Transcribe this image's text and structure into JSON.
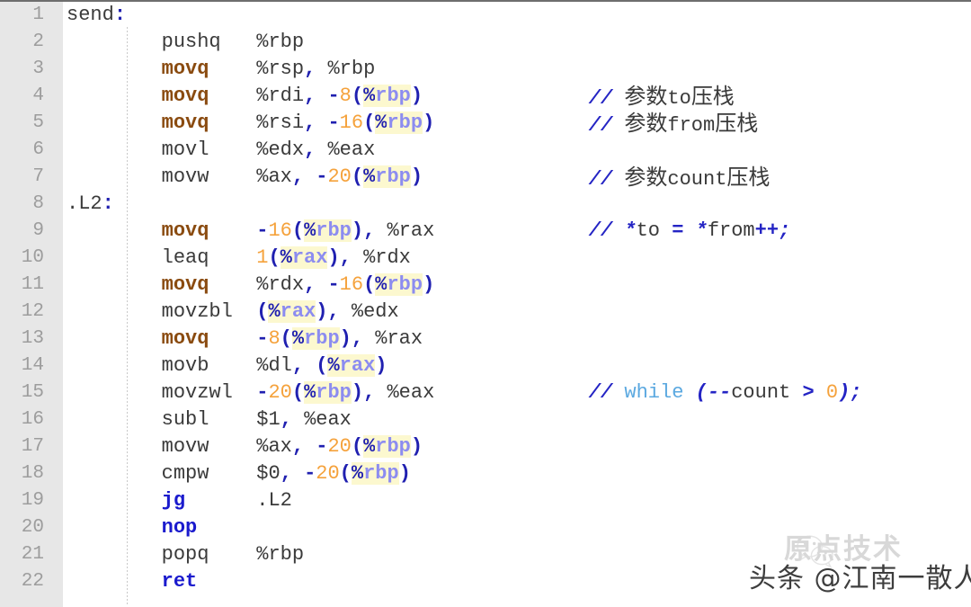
{
  "editor": {
    "language": "x86 AT&T assembly",
    "line_count": 22,
    "gutter_color": "#e7e7e7",
    "background_color": "#ffffff",
    "colors": {
      "mnemonic": "#8a4b10",
      "jump_mnemonic": "#1a1acd",
      "punctuation": "#2020b0",
      "number": "#f5a23c",
      "register": "#8c8cf0",
      "register_highlight": "#fcf8cf",
      "keyword": "#5aa8e0",
      "comment_slash": "#2424c4",
      "plain_text": "#3a3a3a",
      "line_number": "#9d9d9d"
    }
  },
  "line_numbers": [
    "1",
    "2",
    "3",
    "4",
    "5",
    "6",
    "7",
    "8",
    "9",
    "10",
    "11",
    "12",
    "13",
    "14",
    "15",
    "16",
    "17",
    "18",
    "19",
    "20",
    "21",
    "22"
  ],
  "lines": [
    {
      "n": "1",
      "plain": "send:",
      "tokens": [
        {
          "t": "send",
          "c": "t-label"
        },
        {
          "t": ":",
          "c": "t-punct"
        }
      ]
    },
    {
      "n": "2",
      "plain": "        pushq   %rbp",
      "tokens": [
        {
          "t": "        ",
          "c": "t-plain"
        },
        {
          "t": "pushq",
          "c": "t-plain"
        },
        {
          "t": "   ",
          "c": "t-plain"
        },
        {
          "t": "%rbp",
          "c": "t-plain"
        }
      ]
    },
    {
      "n": "3",
      "plain": "        movq    %rsp, %rbp",
      "tokens": [
        {
          "t": "        ",
          "c": "t-plain"
        },
        {
          "t": "movq",
          "c": "t-mnem"
        },
        {
          "t": "    ",
          "c": "t-plain"
        },
        {
          "t": "%rsp",
          "c": "t-plain"
        },
        {
          "t": ",",
          "c": "t-punct"
        },
        {
          "t": " ",
          "c": "t-plain"
        },
        {
          "t": "%rbp",
          "c": "t-plain"
        }
      ]
    },
    {
      "n": "4",
      "plain": "        movq    %rdi, -8(%rbp)",
      "comment": "// 参数to压栈",
      "tokens": [
        {
          "t": "        ",
          "c": "t-plain"
        },
        {
          "t": "movq",
          "c": "t-mnem"
        },
        {
          "t": "    ",
          "c": "t-plain"
        },
        {
          "t": "%rdi",
          "c": "t-plain"
        },
        {
          "t": ",",
          "c": "t-punct"
        },
        {
          "t": " ",
          "c": "t-plain"
        },
        {
          "t": "-",
          "c": "t-punct"
        },
        {
          "t": "8",
          "c": "t-num"
        },
        {
          "t": "(",
          "c": "t-punct"
        },
        {
          "t": "%",
          "c": "t-punct hl"
        },
        {
          "t": "rbp",
          "c": "t-reg hl"
        },
        {
          "t": ")",
          "c": "t-punct"
        }
      ],
      "comment_tokens": [
        {
          "t": "//",
          "c": "t-com-slash"
        },
        {
          "t": " ",
          "c": "t-com-text"
        },
        {
          "t": "参数",
          "c": "t-com-cjk"
        },
        {
          "t": "to",
          "c": "t-com-text"
        },
        {
          "t": "压栈",
          "c": "t-com-cjk"
        }
      ]
    },
    {
      "n": "5",
      "plain": "        movq    %rsi, -16(%rbp)",
      "comment": "// 参数from压栈",
      "tokens": [
        {
          "t": "        ",
          "c": "t-plain"
        },
        {
          "t": "movq",
          "c": "t-mnem"
        },
        {
          "t": "    ",
          "c": "t-plain"
        },
        {
          "t": "%rsi",
          "c": "t-plain"
        },
        {
          "t": ",",
          "c": "t-punct"
        },
        {
          "t": " ",
          "c": "t-plain"
        },
        {
          "t": "-",
          "c": "t-punct"
        },
        {
          "t": "16",
          "c": "t-num"
        },
        {
          "t": "(",
          "c": "t-punct"
        },
        {
          "t": "%",
          "c": "t-punct hl"
        },
        {
          "t": "rbp",
          "c": "t-reg hl"
        },
        {
          "t": ")",
          "c": "t-punct"
        }
      ],
      "comment_tokens": [
        {
          "t": "//",
          "c": "t-com-slash"
        },
        {
          "t": " ",
          "c": "t-com-text"
        },
        {
          "t": "参数",
          "c": "t-com-cjk"
        },
        {
          "t": "from",
          "c": "t-com-text"
        },
        {
          "t": "压栈",
          "c": "t-com-cjk"
        }
      ]
    },
    {
      "n": "6",
      "plain": "        movl    %edx, %eax",
      "tokens": [
        {
          "t": "        ",
          "c": "t-plain"
        },
        {
          "t": "movl",
          "c": "t-plain"
        },
        {
          "t": "    ",
          "c": "t-plain"
        },
        {
          "t": "%edx",
          "c": "t-plain"
        },
        {
          "t": ",",
          "c": "t-punct"
        },
        {
          "t": " ",
          "c": "t-plain"
        },
        {
          "t": "%eax",
          "c": "t-plain"
        }
      ]
    },
    {
      "n": "7",
      "plain": "        movw    %ax, -20(%rbp)",
      "comment": "// 参数count压栈",
      "tokens": [
        {
          "t": "        ",
          "c": "t-plain"
        },
        {
          "t": "movw",
          "c": "t-plain"
        },
        {
          "t": "    ",
          "c": "t-plain"
        },
        {
          "t": "%ax",
          "c": "t-plain"
        },
        {
          "t": ",",
          "c": "t-punct"
        },
        {
          "t": " ",
          "c": "t-plain"
        },
        {
          "t": "-",
          "c": "t-punct"
        },
        {
          "t": "20",
          "c": "t-num"
        },
        {
          "t": "(",
          "c": "t-punct"
        },
        {
          "t": "%",
          "c": "t-punct hl"
        },
        {
          "t": "rbp",
          "c": "t-reg hl"
        },
        {
          "t": ")",
          "c": "t-punct"
        }
      ],
      "comment_tokens": [
        {
          "t": "//",
          "c": "t-com-slash"
        },
        {
          "t": " ",
          "c": "t-com-text"
        },
        {
          "t": "参数",
          "c": "t-com-cjk"
        },
        {
          "t": "count",
          "c": "t-com-text"
        },
        {
          "t": "压栈",
          "c": "t-com-cjk"
        }
      ]
    },
    {
      "n": "8",
      "plain": ".L2:",
      "tokens": [
        {
          "t": ".L2",
          "c": "t-label"
        },
        {
          "t": ":",
          "c": "t-punct"
        }
      ]
    },
    {
      "n": "9",
      "plain": "        movq    -16(%rbp), %rax",
      "comment": "// *to = *from++;",
      "tokens": [
        {
          "t": "        ",
          "c": "t-plain"
        },
        {
          "t": "movq",
          "c": "t-mnem"
        },
        {
          "t": "    ",
          "c": "t-plain"
        },
        {
          "t": "-",
          "c": "t-punct"
        },
        {
          "t": "16",
          "c": "t-num"
        },
        {
          "t": "(",
          "c": "t-punct"
        },
        {
          "t": "%",
          "c": "t-punct hl"
        },
        {
          "t": "rbp",
          "c": "t-reg hl"
        },
        {
          "t": ")",
          "c": "t-punct"
        },
        {
          "t": ",",
          "c": "t-punct"
        },
        {
          "t": " ",
          "c": "t-plain"
        },
        {
          "t": "%rax",
          "c": "t-plain"
        }
      ],
      "comment_tokens": [
        {
          "t": "//",
          "c": "t-com-slash"
        },
        {
          "t": " ",
          "c": "t-com-text"
        },
        {
          "t": "*",
          "c": "t-com-slash"
        },
        {
          "t": "to",
          "c": "t-com-text"
        },
        {
          "t": " ",
          "c": "t-com-text"
        },
        {
          "t": "=",
          "c": "t-com-slash"
        },
        {
          "t": " ",
          "c": "t-com-text"
        },
        {
          "t": "*",
          "c": "t-com-slash"
        },
        {
          "t": "from",
          "c": "t-com-text"
        },
        {
          "t": "++;",
          "c": "t-com-slash"
        }
      ]
    },
    {
      "n": "10",
      "plain": "        leaq    1(%rax), %rdx",
      "tokens": [
        {
          "t": "        ",
          "c": "t-plain"
        },
        {
          "t": "leaq",
          "c": "t-plain"
        },
        {
          "t": "    ",
          "c": "t-plain"
        },
        {
          "t": "1",
          "c": "t-num"
        },
        {
          "t": "(",
          "c": "t-punct"
        },
        {
          "t": "%",
          "c": "t-punct hl"
        },
        {
          "t": "rax",
          "c": "t-reg hl"
        },
        {
          "t": ")",
          "c": "t-punct"
        },
        {
          "t": ",",
          "c": "t-punct"
        },
        {
          "t": " ",
          "c": "t-plain"
        },
        {
          "t": "%rdx",
          "c": "t-plain"
        }
      ]
    },
    {
      "n": "11",
      "plain": "        movq    %rdx, -16(%rbp)",
      "tokens": [
        {
          "t": "        ",
          "c": "t-plain"
        },
        {
          "t": "movq",
          "c": "t-mnem"
        },
        {
          "t": "    ",
          "c": "t-plain"
        },
        {
          "t": "%rdx",
          "c": "t-plain"
        },
        {
          "t": ",",
          "c": "t-punct"
        },
        {
          "t": " ",
          "c": "t-plain"
        },
        {
          "t": "-",
          "c": "t-punct"
        },
        {
          "t": "16",
          "c": "t-num"
        },
        {
          "t": "(",
          "c": "t-punct"
        },
        {
          "t": "%",
          "c": "t-punct hl"
        },
        {
          "t": "rbp",
          "c": "t-reg hl"
        },
        {
          "t": ")",
          "c": "t-punct"
        }
      ]
    },
    {
      "n": "12",
      "plain": "        movzbl  (%rax), %edx",
      "tokens": [
        {
          "t": "        ",
          "c": "t-plain"
        },
        {
          "t": "movzbl",
          "c": "t-plain"
        },
        {
          "t": "  ",
          "c": "t-plain"
        },
        {
          "t": "(",
          "c": "t-punct"
        },
        {
          "t": "%",
          "c": "t-punct hl"
        },
        {
          "t": "rax",
          "c": "t-reg hl"
        },
        {
          "t": ")",
          "c": "t-punct"
        },
        {
          "t": ",",
          "c": "t-punct"
        },
        {
          "t": " ",
          "c": "t-plain"
        },
        {
          "t": "%edx",
          "c": "t-plain"
        }
      ]
    },
    {
      "n": "13",
      "plain": "        movq    -8(%rbp), %rax",
      "tokens": [
        {
          "t": "        ",
          "c": "t-plain"
        },
        {
          "t": "movq",
          "c": "t-mnem"
        },
        {
          "t": "    ",
          "c": "t-plain"
        },
        {
          "t": "-",
          "c": "t-punct"
        },
        {
          "t": "8",
          "c": "t-num"
        },
        {
          "t": "(",
          "c": "t-punct"
        },
        {
          "t": "%",
          "c": "t-punct hl"
        },
        {
          "t": "rbp",
          "c": "t-reg hl"
        },
        {
          "t": ")",
          "c": "t-punct"
        },
        {
          "t": ",",
          "c": "t-punct"
        },
        {
          "t": " ",
          "c": "t-plain"
        },
        {
          "t": "%rax",
          "c": "t-plain"
        }
      ]
    },
    {
      "n": "14",
      "plain": "        movb    %dl, (%rax)",
      "tokens": [
        {
          "t": "        ",
          "c": "t-plain"
        },
        {
          "t": "movb",
          "c": "t-plain"
        },
        {
          "t": "    ",
          "c": "t-plain"
        },
        {
          "t": "%dl",
          "c": "t-plain"
        },
        {
          "t": ",",
          "c": "t-punct"
        },
        {
          "t": " ",
          "c": "t-plain"
        },
        {
          "t": "(",
          "c": "t-punct"
        },
        {
          "t": "%",
          "c": "t-punct hl"
        },
        {
          "t": "rax",
          "c": "t-reg hl"
        },
        {
          "t": ")",
          "c": "t-punct"
        }
      ]
    },
    {
      "n": "15",
      "plain": "        movzwl  -20(%rbp), %eax",
      "comment": "// while (--count > 0);",
      "tokens": [
        {
          "t": "        ",
          "c": "t-plain"
        },
        {
          "t": "movzwl",
          "c": "t-plain"
        },
        {
          "t": "  ",
          "c": "t-plain"
        },
        {
          "t": "-",
          "c": "t-punct"
        },
        {
          "t": "20",
          "c": "t-num"
        },
        {
          "t": "(",
          "c": "t-punct"
        },
        {
          "t": "%",
          "c": "t-punct hl"
        },
        {
          "t": "rbp",
          "c": "t-reg hl"
        },
        {
          "t": ")",
          "c": "t-punct"
        },
        {
          "t": ",",
          "c": "t-punct"
        },
        {
          "t": " ",
          "c": "t-plain"
        },
        {
          "t": "%eax",
          "c": "t-plain"
        }
      ],
      "comment_tokens": [
        {
          "t": "//",
          "c": "t-com-slash"
        },
        {
          "t": " ",
          "c": "t-com-text"
        },
        {
          "t": "while",
          "c": "t-kw"
        },
        {
          "t": " ",
          "c": "t-com-text"
        },
        {
          "t": "(--",
          "c": "t-com-slash"
        },
        {
          "t": "count",
          "c": "t-com-text"
        },
        {
          "t": " ",
          "c": "t-com-text"
        },
        {
          "t": ">",
          "c": "t-com-slash"
        },
        {
          "t": " ",
          "c": "t-com-text"
        },
        {
          "t": "0",
          "c": "t-num"
        },
        {
          "t": ");",
          "c": "t-com-slash"
        }
      ]
    },
    {
      "n": "16",
      "plain": "        subl    $1, %eax",
      "tokens": [
        {
          "t": "        ",
          "c": "t-plain"
        },
        {
          "t": "subl",
          "c": "t-plain"
        },
        {
          "t": "    ",
          "c": "t-plain"
        },
        {
          "t": "$1",
          "c": "t-plain"
        },
        {
          "t": ",",
          "c": "t-punct"
        },
        {
          "t": " ",
          "c": "t-plain"
        },
        {
          "t": "%eax",
          "c": "t-plain"
        }
      ]
    },
    {
      "n": "17",
      "plain": "        movw    %ax, -20(%rbp)",
      "tokens": [
        {
          "t": "        ",
          "c": "t-plain"
        },
        {
          "t": "movw",
          "c": "t-plain"
        },
        {
          "t": "    ",
          "c": "t-plain"
        },
        {
          "t": "%ax",
          "c": "t-plain"
        },
        {
          "t": ",",
          "c": "t-punct"
        },
        {
          "t": " ",
          "c": "t-plain"
        },
        {
          "t": "-",
          "c": "t-punct"
        },
        {
          "t": "20",
          "c": "t-num"
        },
        {
          "t": "(",
          "c": "t-punct"
        },
        {
          "t": "%",
          "c": "t-punct hl"
        },
        {
          "t": "rbp",
          "c": "t-reg hl"
        },
        {
          "t": ")",
          "c": "t-punct"
        }
      ]
    },
    {
      "n": "18",
      "plain": "        cmpw    $0, -20(%rbp)",
      "tokens": [
        {
          "t": "        ",
          "c": "t-plain"
        },
        {
          "t": "cmpw",
          "c": "t-plain"
        },
        {
          "t": "    ",
          "c": "t-plain"
        },
        {
          "t": "$0",
          "c": "t-plain"
        },
        {
          "t": ",",
          "c": "t-punct"
        },
        {
          "t": " ",
          "c": "t-plain"
        },
        {
          "t": "-",
          "c": "t-punct"
        },
        {
          "t": "20",
          "c": "t-num"
        },
        {
          "t": "(",
          "c": "t-punct"
        },
        {
          "t": "%",
          "c": "t-punct hl"
        },
        {
          "t": "rbp",
          "c": "t-reg hl"
        },
        {
          "t": ")",
          "c": "t-punct"
        }
      ]
    },
    {
      "n": "19",
      "plain": "        jg      .L2",
      "tokens": [
        {
          "t": "        ",
          "c": "t-plain"
        },
        {
          "t": "jg",
          "c": "t-jump"
        },
        {
          "t": "      ",
          "c": "t-plain"
        },
        {
          "t": ".L2",
          "c": "t-plain"
        }
      ]
    },
    {
      "n": "20",
      "plain": "        nop",
      "tokens": [
        {
          "t": "        ",
          "c": "t-plain"
        },
        {
          "t": "nop",
          "c": "t-jump"
        }
      ]
    },
    {
      "n": "21",
      "plain": "        popq    %rbp",
      "tokens": [
        {
          "t": "        ",
          "c": "t-plain"
        },
        {
          "t": "popq",
          "c": "t-plain"
        },
        {
          "t": "    ",
          "c": "t-plain"
        },
        {
          "t": "%rbp",
          "c": "t-plain"
        }
      ]
    },
    {
      "n": "22",
      "plain": "        ret",
      "tokens": [
        {
          "t": "        ",
          "c": "t-plain"
        },
        {
          "t": "ret",
          "c": "t-jump"
        }
      ]
    }
  ],
  "watermarks": {
    "light": "原点技术",
    "dark": "头条 @江南一散人",
    "icon": "wechat-logo"
  }
}
